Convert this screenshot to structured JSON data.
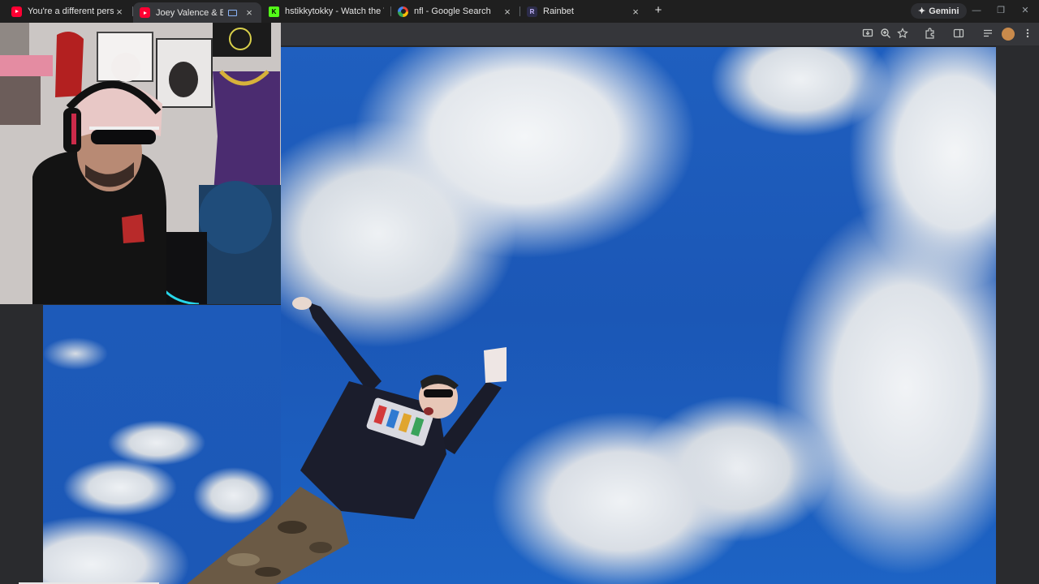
{
  "browser": {
    "tabs": [
      {
        "title": "You're a different perso",
        "favicon": "youtube-icon",
        "media": false,
        "active": false
      },
      {
        "title": "Joey Valence & Brae - Doul",
        "favicon": "youtube-icon",
        "media": true,
        "active": true
      },
      {
        "title": "hstikkytokky - Watch the VOD ",
        "favicon": "kick-icon",
        "media": false,
        "active": false
      },
      {
        "title": "nfl - Google Search",
        "favicon": "google-icon",
        "media": false,
        "active": false
      },
      {
        "title": "Rainbet",
        "favicon": "rainbet-icon",
        "media": false,
        "active": false
      }
    ],
    "new_tab_symbol": "+",
    "gemini_label": "Gemini",
    "close_symbol": "×",
    "kick_letter": "K",
    "rainbet_letter": "R",
    "gemini_symbol": "✦",
    "window_controls": {
      "minimize": "—",
      "restore": "❐",
      "close": "✕"
    },
    "toolbar_icons": [
      "install-app-icon",
      "zoom-icon",
      "bookmark-star-icon",
      "extensions-icon",
      "side-panel-icon",
      "reading-list-icon",
      "profile-avatar",
      "menu-icon"
    ]
  },
  "colors": {
    "tab_bar": "#1f1f1f",
    "active_tab": "#35363a",
    "youtube_red": "#ff0033",
    "kick_green": "#53fc18",
    "sky_blue": "#1f5fbf",
    "cloud_white": "#eef1f4"
  }
}
